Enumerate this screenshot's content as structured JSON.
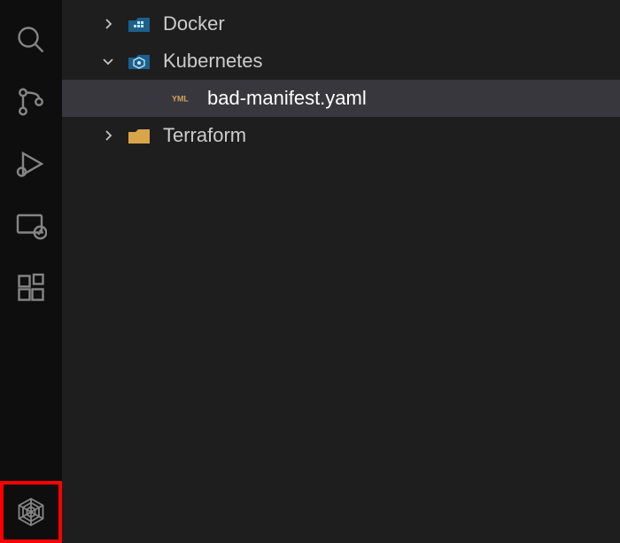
{
  "explorer": {
    "items": [
      {
        "label": "Docker",
        "type": "folder",
        "icon": "docker",
        "expanded": false,
        "depth": 0,
        "selected": false
      },
      {
        "label": "Kubernetes",
        "type": "folder",
        "icon": "kubernetes",
        "expanded": true,
        "depth": 0,
        "selected": false
      },
      {
        "label": "bad-manifest.yaml",
        "type": "file",
        "icon": "yaml",
        "depth": 1,
        "selected": true
      },
      {
        "label": "Terraform",
        "type": "folder",
        "icon": "terraform",
        "expanded": false,
        "depth": 0,
        "selected": false
      }
    ]
  },
  "activityBar": {
    "items": [
      {
        "name": "search"
      },
      {
        "name": "source-control"
      },
      {
        "name": "run-debug"
      },
      {
        "name": "remote-explorer"
      },
      {
        "name": "extensions"
      }
    ],
    "bottom": {
      "name": "trivy-scanner",
      "highlighted": true
    }
  },
  "colors": {
    "background": "#1e1e1e",
    "activityBar": "#0e0e0e",
    "selection": "#37373d",
    "highlight": "#ff0000"
  }
}
